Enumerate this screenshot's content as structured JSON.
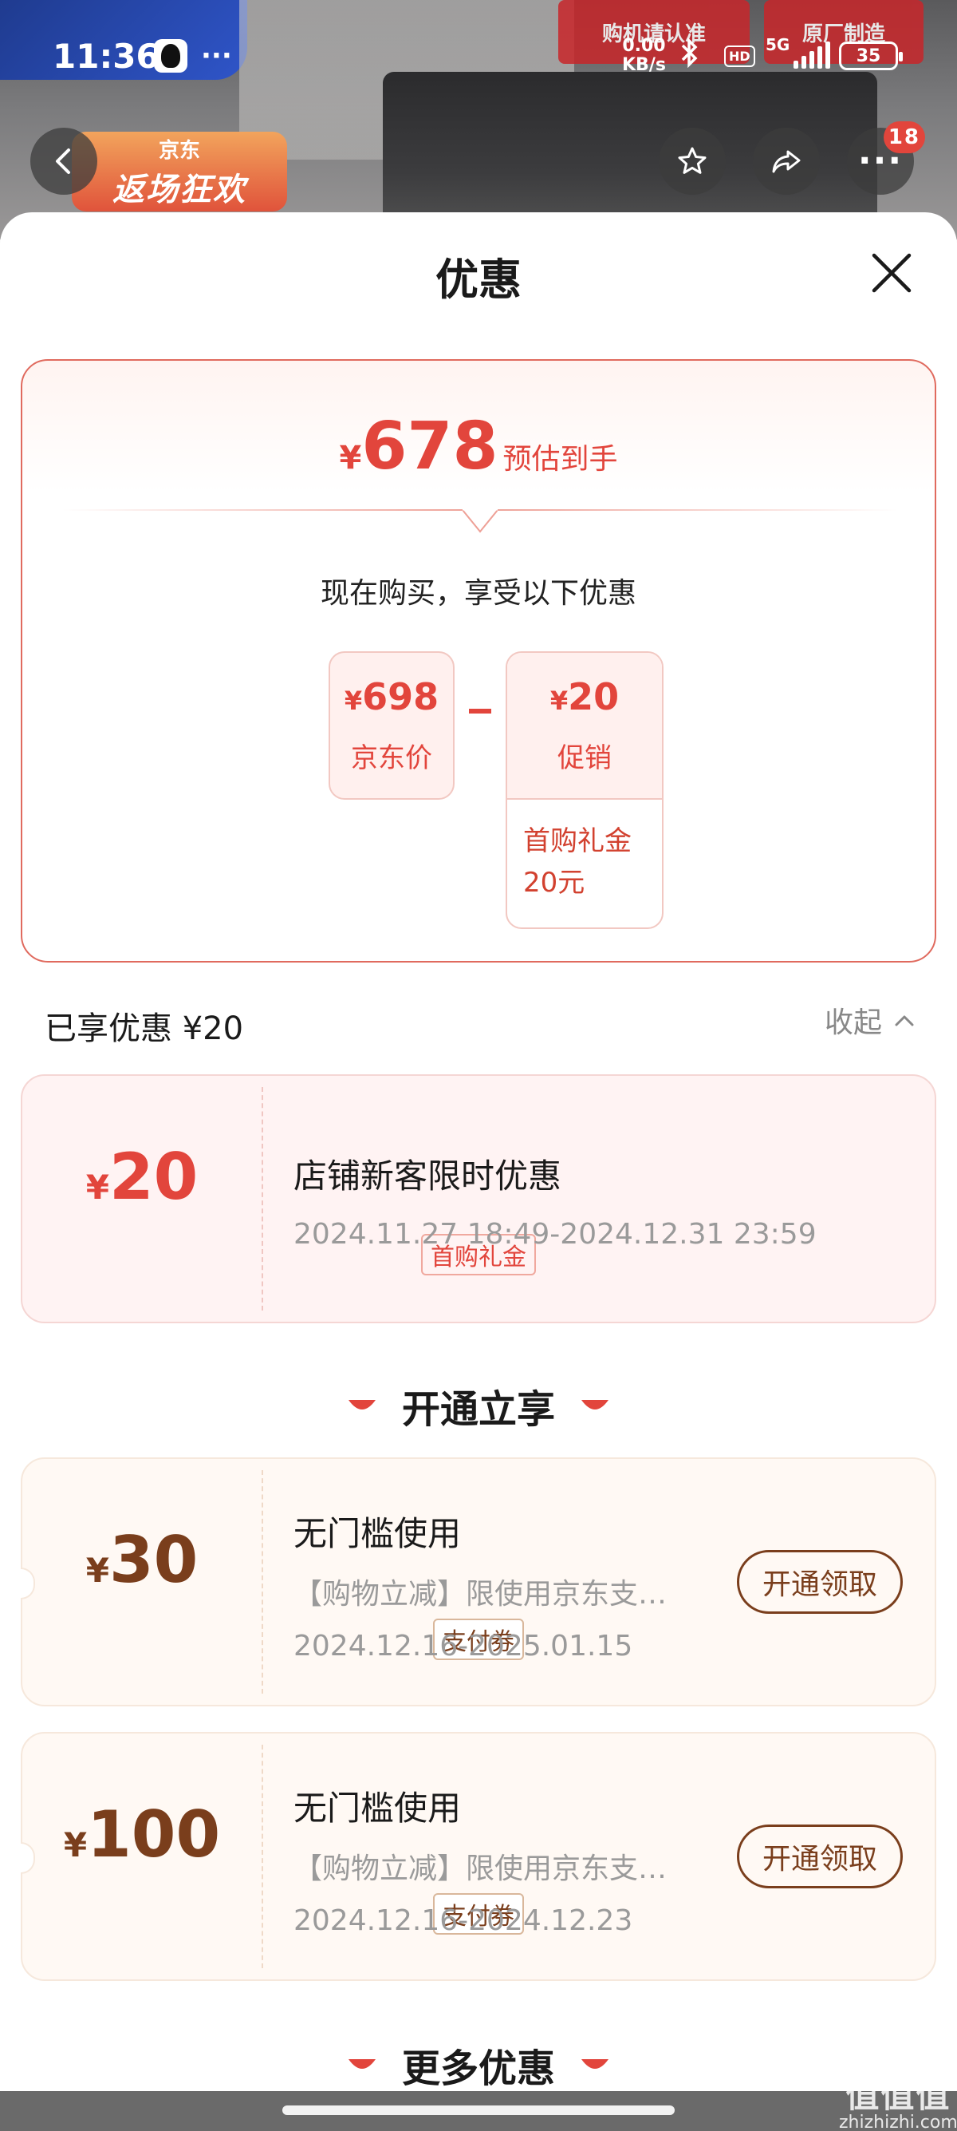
{
  "status_bar": {
    "time": "11:36",
    "dots": "···",
    "speed_value": "0.00",
    "speed_unit": "KB/s",
    "hd": "HD",
    "network": "5G",
    "battery": "35"
  },
  "background": {
    "badge_1": "购机请认准",
    "badge_2": "原厂制造",
    "promo_top": "京东",
    "promo_main": "返场狂欢"
  },
  "nav": {
    "more_badge": "18"
  },
  "sheet": {
    "title": "优惠"
  },
  "summary": {
    "currency": "¥",
    "estimated_amount": "678",
    "estimated_label": "预估到手",
    "buy_now_text": "现在购买，享受以下优惠",
    "jd_price_value": "698",
    "jd_price_label": "京东价",
    "promo_value": "20",
    "promo_label": "促销",
    "promo_detail": "首购礼金20元"
  },
  "enjoyed": {
    "label": "已享优惠 ¥20",
    "collapse_label": "收起"
  },
  "enjoyed_coupon": {
    "currency": "¥",
    "amount": "20",
    "tag": "首购礼金",
    "title": "店铺新客限时优惠",
    "validity": "2024.11.27 18:49-2024.12.31 23:59"
  },
  "section_activate": {
    "title": "开通立享"
  },
  "activate_coupons": [
    {
      "currency": "¥",
      "amount": "30",
      "tag": "支付券",
      "title": "无门槛使用",
      "subtitle": "【购物立减】限使用京东支…",
      "validity": "2024.12.16-2025.01.15",
      "button": "开通领取"
    },
    {
      "currency": "¥",
      "amount": "100",
      "tag": "支付券",
      "title": "无门槛使用",
      "subtitle": "【购物立减】限使用京东支…",
      "validity": "2024.12.16-2024.12.23",
      "button": "开通领取"
    }
  ],
  "section_more": {
    "title": "更多优惠"
  },
  "watermark": {
    "logo": "值值值",
    "site": "zhizhizhi.com"
  },
  "colors": {
    "accent_red": "#e2453c",
    "coupon_brown": "#7a3e1c"
  }
}
